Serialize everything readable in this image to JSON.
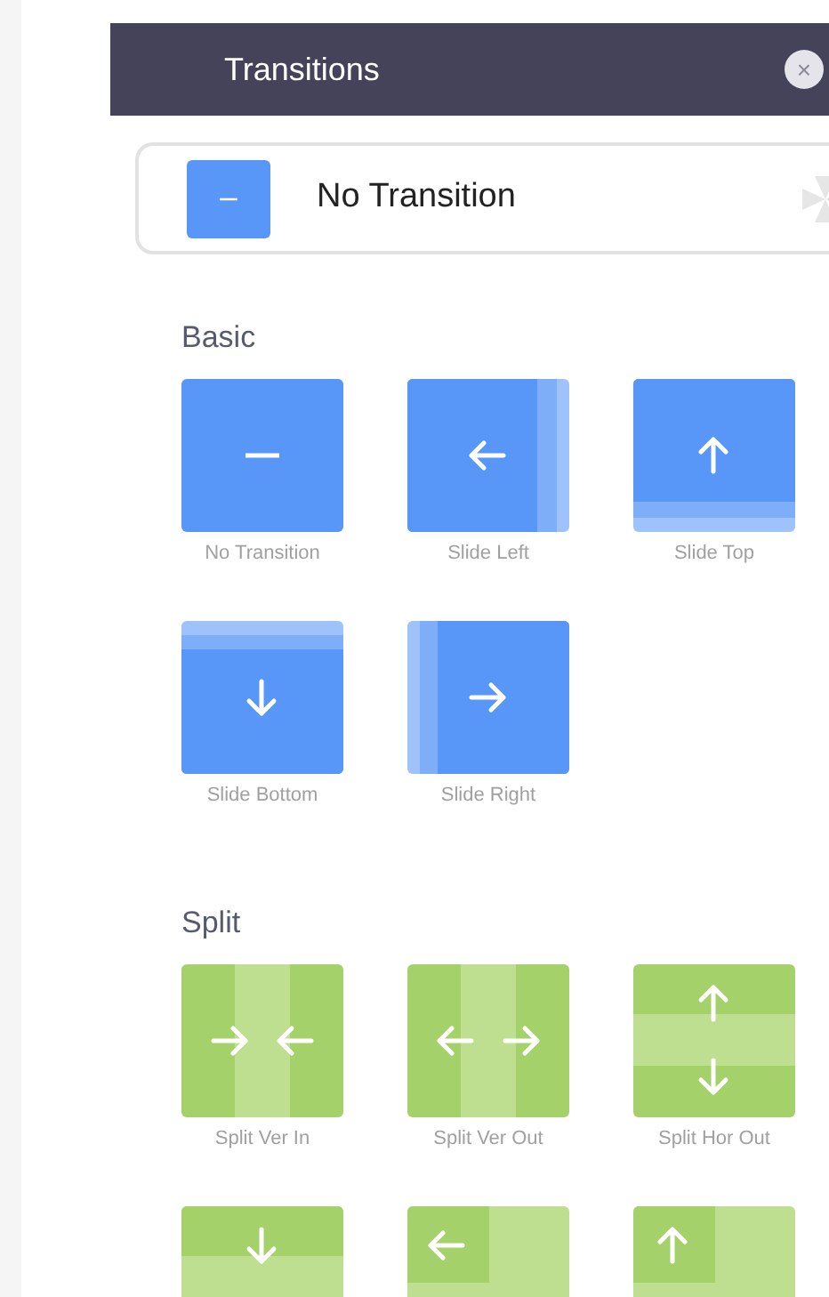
{
  "panel": {
    "title": "Transitions",
    "close": "×"
  },
  "current": {
    "label": "No Transition",
    "kind": "none"
  },
  "sections": [
    {
      "title": "Basic",
      "items": [
        {
          "label": "No Transition",
          "kind": "none"
        },
        {
          "label": "Slide Left",
          "kind": "slide-left"
        },
        {
          "label": "Slide Top",
          "kind": "slide-top"
        },
        {
          "label": "Slide Bottom",
          "kind": "slide-bottom"
        },
        {
          "label": "Slide Right",
          "kind": "slide-right"
        }
      ]
    },
    {
      "title": "Split",
      "items": [
        {
          "label": "Split Ver In",
          "kind": "split-ver-in"
        },
        {
          "label": "Split Ver Out",
          "kind": "split-ver-out"
        },
        {
          "label": "Split Hor Out",
          "kind": "split-hor-out"
        },
        {
          "kind": "split-hor-in"
        },
        {
          "kind": "corner-left"
        },
        {
          "kind": "corner-up"
        }
      ]
    }
  ]
}
